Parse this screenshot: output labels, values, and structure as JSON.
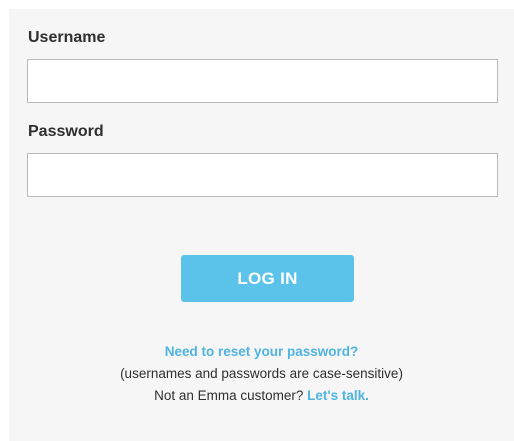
{
  "login_form": {
    "username_label": "Username",
    "username_value": "",
    "password_label": "Password",
    "password_value": "",
    "login_button_label": "LOG IN"
  },
  "help": {
    "reset_password_link": "Need to reset your password?",
    "case_sensitive_note": "(usernames and passwords are case-sensitive)",
    "not_customer_text": "Not an Emma customer? ",
    "lets_talk_link": "Let's talk."
  },
  "colors": {
    "panel_background": "#f6f6f6",
    "button_background": "#5bc3ea",
    "link_color": "#4fb4e0"
  }
}
